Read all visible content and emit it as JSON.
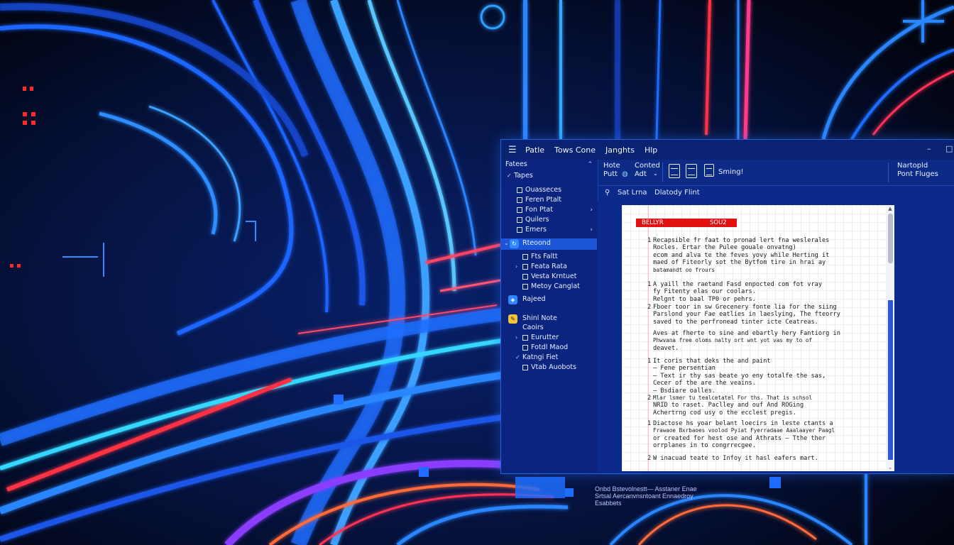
{
  "window": {
    "menu": [
      "Patle",
      "Tows Cone",
      "Janghts",
      "Hlp"
    ],
    "controls": {
      "minimize": "–",
      "maximize": "□"
    }
  },
  "ribbon": {
    "group1_line1": "Hote",
    "group1_line2": "Putt",
    "group2_line1": "Conted",
    "group2_line2": "Adt",
    "saving_label": "Sming!",
    "right_line1": "Nartopld",
    "right_line2": "Pont Fluges"
  },
  "path": {
    "label": "Sat Lrna",
    "doc": "Dlatody Flint"
  },
  "nav": {
    "header": "Fatees",
    "items": [
      {
        "label": "Tapes"
      },
      {
        "label": "Ouasseces"
      },
      {
        "label": "Feren Ptalt"
      },
      {
        "label": "Fon Ptat"
      },
      {
        "label": "Quilers"
      },
      {
        "label": "Emers"
      },
      {
        "label": "Rteoond"
      },
      {
        "label": "Fts Faltt"
      },
      {
        "label": "Feata Rata"
      },
      {
        "label": "Vesta Krntuet"
      },
      {
        "label": "Metoy Canglat"
      },
      {
        "label": "Rajeed"
      },
      {
        "label": "Shinl Note"
      },
      {
        "label": "Caoirs"
      },
      {
        "label": "Eurutter"
      },
      {
        "label": "Fotdl Maod"
      },
      {
        "label": "Katngi Fiet"
      },
      {
        "label": "Vtab Auobots"
      }
    ]
  },
  "document": {
    "heading_left": "BELLYR",
    "heading_right": "SOU2",
    "paragraphs": [
      {
        "num": "1",
        "lines": [
          "Recapsible fr faat to pronad lert fna weslerales",
          "Rocles. Ertar the Pulee gouale onvatng)",
          "ecom and alva te the feves yovy while Herting it",
          "maed of Fiteorly sot the Bytfom tire in hrai ay",
          "batamandt oo frours"
        ]
      },
      {
        "num": "1",
        "lines": [
          "A yaill the raetand Fasd enpocted com fot vray",
          "fy Fitenty elas our coolars.",
          "Relgnt to baal TP0 or pehrs."
        ]
      },
      {
        "num": "2",
        "lines": [
          "Fboer toor in sw Grecenery fonte lia for the siing",
          "Parslond your Fae eatlies in laeslying, The fteorry",
          "saved to the perfronead tinter icte Ceatreas."
        ]
      },
      {
        "num": "",
        "lines": [
          "Aves at fherte to sine and ebartly hery Fantiorg in",
          "Phwvana free oloms nalty ort wnt yot vas my to of",
          "deavet."
        ]
      },
      {
        "num": "1",
        "lines": [
          "It coris that deks the and paint",
          "– Fene persentian",
          "– Text ir thy sas beate yo eny totalfe the sas,",
          "Cecer of the are the veains.",
          "– Bsdiare oalles."
        ]
      },
      {
        "num": "2",
        "lines": [
          "Mlar lsmer tu tealcetatel For ths. That is schsol",
          "NRID to raset. Paclley and ouf And ROGing",
          "Achertrng cod usy o the ecclest pregis."
        ]
      },
      {
        "num": "1",
        "lines": [
          "Diactose hs yoar belant loecirs in leste ctants a",
          "Frawaoe Bxrbaoes voolod Pyiat Fyerradaae Aaalaayer Paagl",
          "or created for hest ose and Athrats – Tthe ther",
          "orrplanes in to congrrecgee."
        ]
      },
      {
        "num": "2",
        "lines": [
          "W inacuad teate to Infoy it hasl eafers mart."
        ]
      }
    ]
  },
  "wallpaper": {
    "small_text_1": "Onbd Bstevolnestt— Asstaner Enae",
    "small_text_2": "Srtsal Aercanvnsntoant Ennaedroy",
    "small_text_3": "Esabbets",
    "colors": {
      "primary": "#1f7bff",
      "cyan": "#35d6ff",
      "red": "#ff3344",
      "purple": "#8a3cff"
    }
  }
}
